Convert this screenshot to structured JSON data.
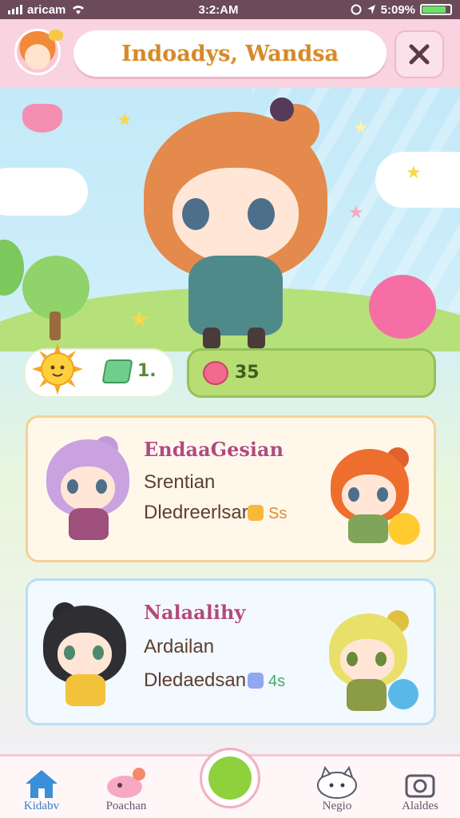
{
  "status_bar": {
    "carrier": "aricam",
    "time": "3:2:AM",
    "battery_text": "5:09%",
    "battery_level": 0.85
  },
  "header": {
    "title": "Indoadys, Wandsa",
    "close_icon": "close-icon"
  },
  "stats": {
    "left_value": "1.",
    "right_value": "35"
  },
  "cards": [
    {
      "title": "EndaaGesian",
      "line1": "Srentian",
      "line2": "Dledreerlsan",
      "badge_value": "Ss",
      "accent": "#f4d197"
    },
    {
      "title": "Nalaalihy",
      "line1": "Ardailan",
      "line2": "Dledaedsan",
      "badge_value": "4s",
      "accent": "#b9def5"
    }
  ],
  "nav": {
    "items": [
      {
        "label": "Kidabv",
        "icon": "home-icon",
        "active": true
      },
      {
        "label": "Poachan",
        "icon": "pet-icon",
        "active": false
      },
      {
        "label": "Negio",
        "icon": "cat-icon",
        "active": false
      },
      {
        "label": "Alaldes",
        "icon": "camera-icon",
        "active": false
      }
    ]
  },
  "colors": {
    "header_pink": "#f9d3df",
    "title_text": "#d58a2c",
    "stat_green": "#b7dd73",
    "card_title": "#b24a7c",
    "nav_active": "#3b7cc0"
  }
}
